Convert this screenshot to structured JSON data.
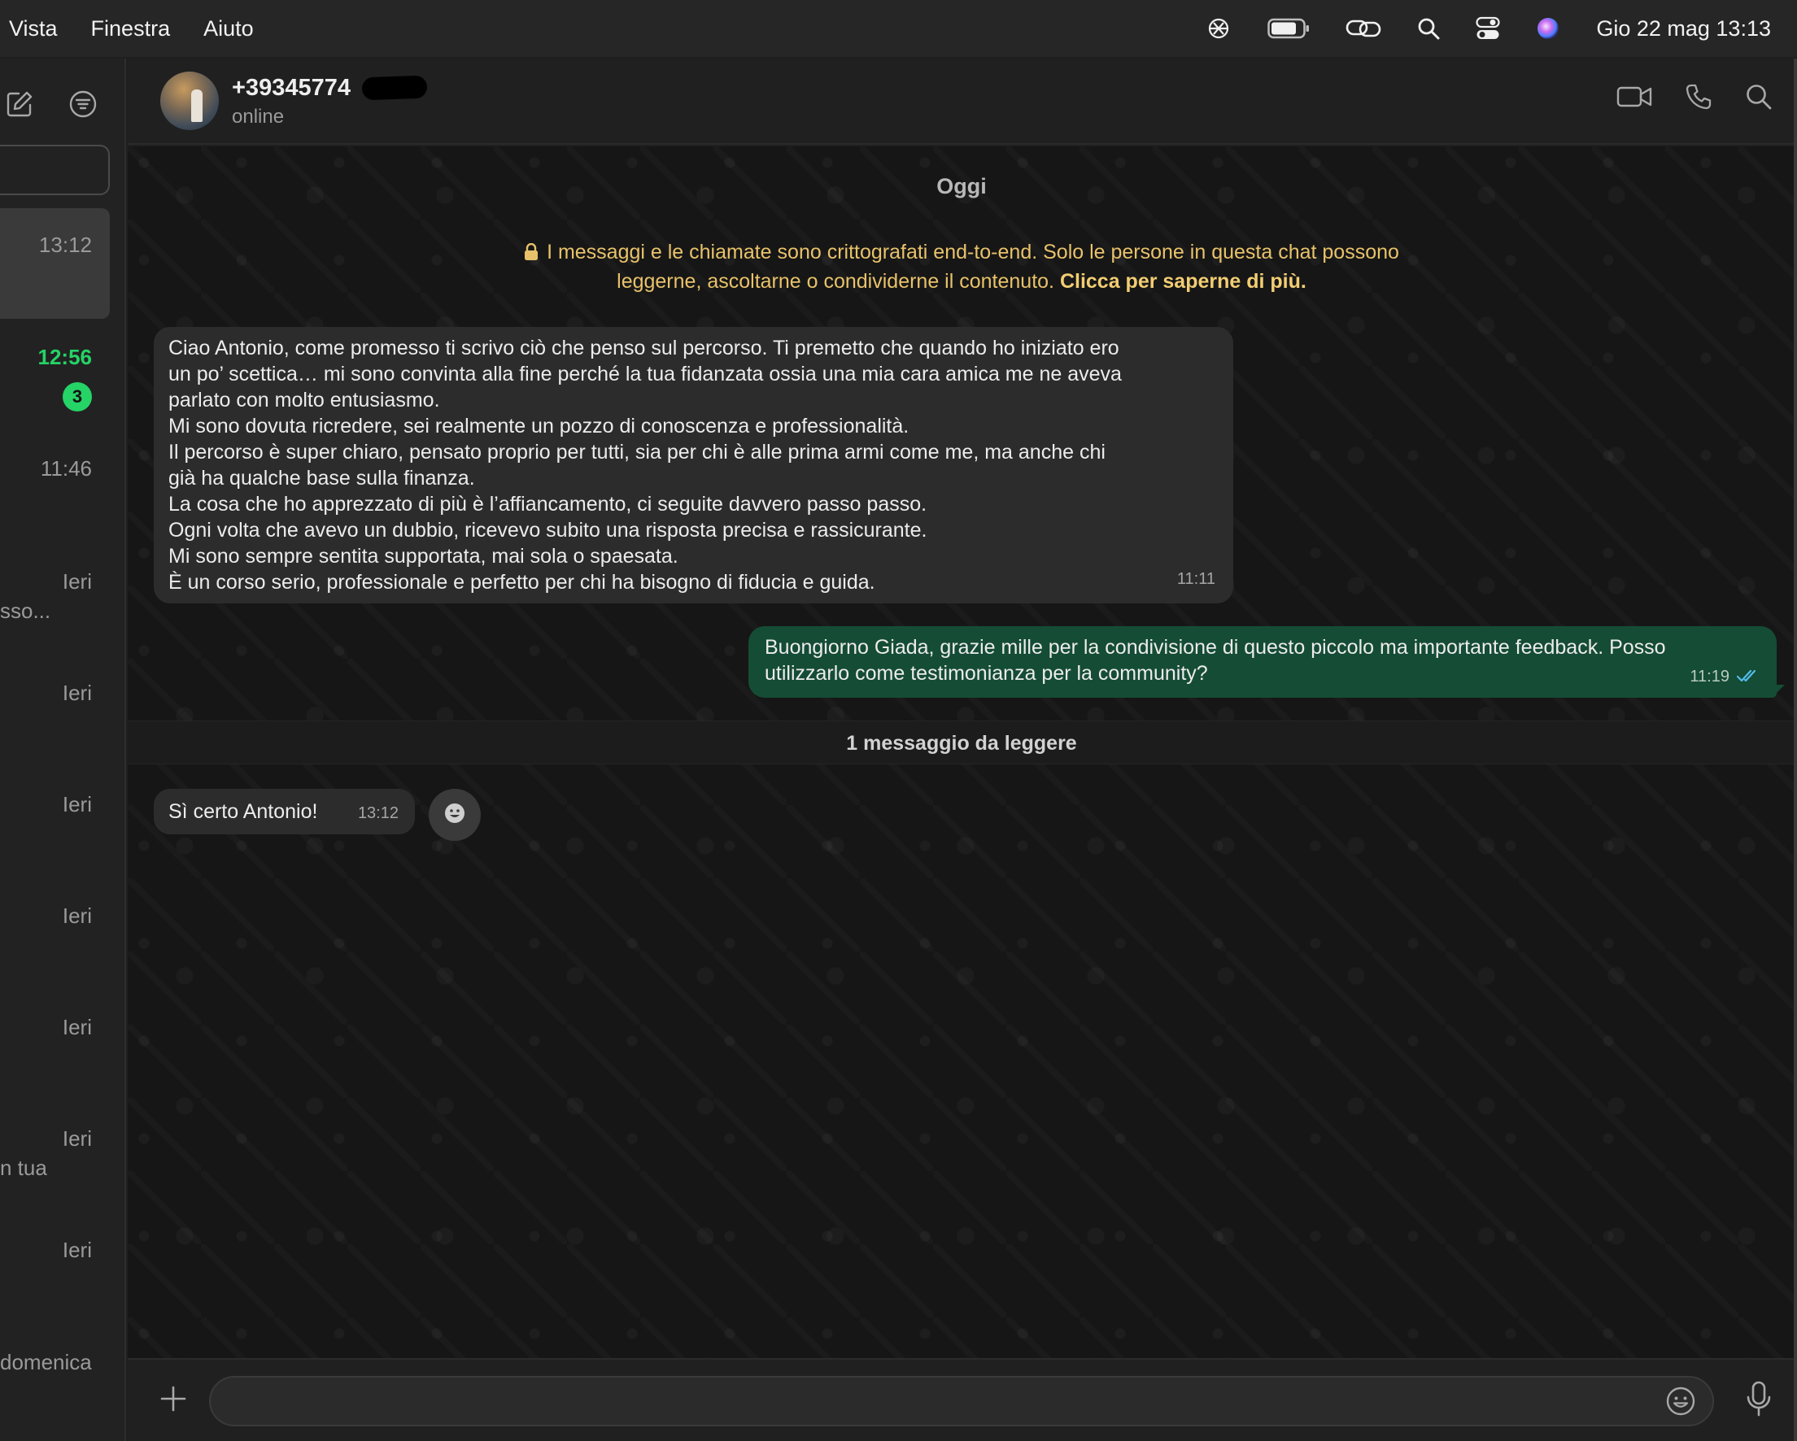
{
  "menubar": {
    "menus": [
      "Vista",
      "Finestra",
      "Aiuto"
    ],
    "clock": "Gio 22 mag  13:13",
    "status_icons": [
      "chatgpt-icon",
      "battery-icon",
      "link-icon",
      "spotlight-search-icon",
      "control-center-icon",
      "siri-icon"
    ]
  },
  "sidebar": {
    "tool_icons": [
      "compose-icon",
      "filter-icon"
    ],
    "chats": [
      {
        "time": "13:12",
        "snippet": "",
        "unread": false
      },
      {
        "time": "12:56",
        "snippet": "",
        "unread": true,
        "badge": "3"
      },
      {
        "time": "11:46",
        "snippet": "",
        "unread": false
      },
      {
        "time": "Ieri",
        "snippet": "sso...",
        "unread": false
      },
      {
        "time": "Ieri",
        "snippet": "",
        "unread": false
      },
      {
        "time": "Ieri",
        "snippet": "",
        "unread": false
      },
      {
        "time": "Ieri",
        "snippet": "",
        "unread": false
      },
      {
        "time": "Ieri",
        "snippet": "",
        "unread": false
      },
      {
        "time": "Ieri",
        "snippet": "n tua",
        "unread": false
      },
      {
        "time": "Ieri",
        "snippet": "",
        "unread": false
      },
      {
        "time": "",
        "snippet": "domenica",
        "unread": false
      }
    ]
  },
  "chat": {
    "contact_name": "+39345774",
    "contact_status": "online",
    "header_actions": [
      "video-call-icon",
      "voice-call-icon",
      "search-icon"
    ],
    "day_label": "Oggi",
    "e2e_notice": {
      "line1": "I messaggi e le chiamate sono crittografati end-to-end. Solo le persone in questa chat possono",
      "line2": "leggerne, ascoltarne o condividerne il contenuto.",
      "learn_more": "Clicca per saperne di più."
    },
    "messages": [
      {
        "direction": "incoming",
        "lines": [
          "Ciao Antonio, come promesso ti scrivo ciò che penso sul percorso. Ti premetto che quando ho iniziato ero",
          "un po’ scettica… mi sono convinta alla fine perché la tua fidanzata ossia una mia cara amica me ne aveva",
          "parlato con molto entusiasmo.",
          "Mi sono dovuta ricredere, sei realmente un pozzo di conoscenza e professionalità.",
          "Il percorso è super chiaro, pensato proprio per tutti, sia per chi è alle prima armi come me, ma anche chi",
          "già ha qualche base sulla finanza.",
          "La cosa che ho apprezzato di più è l’affiancamento, ci seguite davvero passo passo.",
          "Ogni volta che avevo un dubbio, ricevevo subito una risposta precisa e rassicurante.",
          "Mi sono sempre sentita supportata, mai sola o spaesata.",
          "È un corso serio, professionale e perfetto per chi ha bisogno di fiducia e guida."
        ],
        "time": "11:11"
      },
      {
        "direction": "outgoing",
        "lines": [
          "Buongiorno Giada, grazie mille per la condivisione di questo piccolo ma importante feedback. Posso",
          "utilizzarlo come testimonianza per la community?"
        ],
        "time": "11:19",
        "status": "read"
      },
      {
        "direction": "incoming",
        "lines": [
          "Sì certo Antonio!"
        ],
        "time": "13:12"
      }
    ],
    "unread_divider": "1 messaggio da leggere"
  },
  "composer": {
    "placeholder": "",
    "icons": [
      "plus-icon",
      "emoji-icon",
      "microphone-icon"
    ]
  },
  "colors": {
    "incoming_bubble": "#2c2c2c",
    "outgoing_bubble": "#154c35",
    "unread_badge": "#25d366",
    "notice_text": "#e8c26a"
  }
}
